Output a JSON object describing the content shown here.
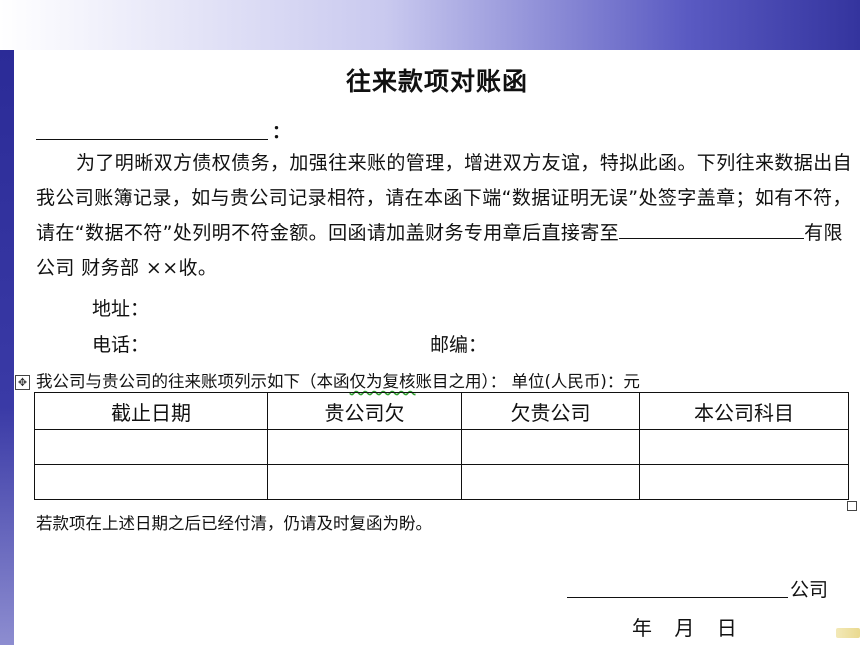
{
  "document": {
    "title": "往来款项对账函",
    "recipient_colon": "：",
    "para1": "为了明晰双方债权债务，加强往来账的管理，增进双方友谊，特拟此函。下列往来数据出自我公司账簿记录，如与贵公司记录相符，请在本函下端“数据证明无误”处签字盖章；如有不符，请在“数据不符”处列明不符金额。回函请加盖财务专用章后直接寄至",
    "para1_tail": "有限公司 财务部 ××收。",
    "address_label": "地址：",
    "phone_label": "电话：",
    "postcode_label": "邮编：",
    "table_intro_pre": "我公司与贵公司的往来账项列示如下（本函",
    "table_intro_mid": "仅为复核",
    "table_intro_post": "账目之用）：  单位(人民币)：元",
    "table": {
      "headers": [
        "截止日期",
        "贵公司欠",
        "欠贵公司",
        "本公司科目"
      ],
      "rows": [
        [
          "",
          "",
          "",
          ""
        ],
        [
          "",
          "",
          "",
          ""
        ]
      ]
    },
    "footnote": "若款项在上述日期之后已经付清，仍请及时复函为盼。",
    "company_suffix": "公司",
    "date_line": "年 月 日"
  },
  "handles": {
    "move_icon": "move-cross-icon",
    "move_glyph": "✥",
    "resize_icon": "resize-square-icon"
  }
}
